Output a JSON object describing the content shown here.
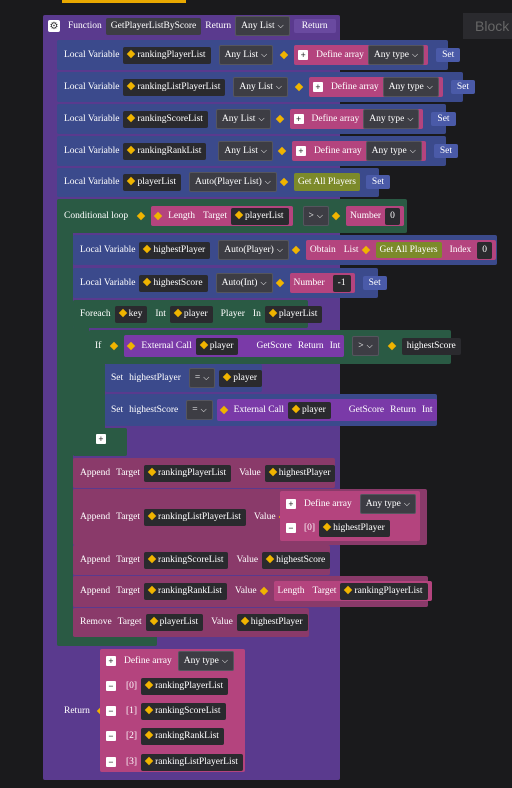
{
  "toolbar": {
    "block_tab": "Block"
  },
  "func": {
    "label": "Function",
    "name": "GetPlayerListByScore",
    "return_label": "Return",
    "return_type": "Any List",
    "return_btn": "Return"
  },
  "locals": [
    {
      "label": "Local Variable",
      "name": "rankingPlayerList",
      "type": "Any List",
      "value_label": "Define array",
      "value_type": "Any type",
      "set": "Set"
    },
    {
      "label": "Local Variable",
      "name": "rankingListPlayerList",
      "type": "Any List",
      "value_label": "Define array",
      "value_type": "Any type",
      "set": "Set"
    },
    {
      "label": "Local Variable",
      "name": "rankingScoreList",
      "type": "Any List",
      "value_label": "Define array",
      "value_type": "Any type",
      "set": "Set"
    },
    {
      "label": "Local Variable",
      "name": "rankingRankList",
      "type": "Any List",
      "value_label": "Define array",
      "value_type": "Any type",
      "set": "Set"
    },
    {
      "label": "Local Variable",
      "name": "playerList",
      "type": "Auto(Player List)",
      "value_label": "Get All Players",
      "set": "Set"
    }
  ],
  "loop": {
    "label": "Conditional loop",
    "length_label": "Length",
    "target_label": "Target",
    "target": "playerList",
    "op": ">",
    "number_label": "Number",
    "number": "0"
  },
  "inner": {
    "hp": {
      "label": "Local Variable",
      "name": "highestPlayer",
      "type": "Auto(Player)",
      "obtain": "Obtain",
      "list_label": "List",
      "list_value": "Get All Players",
      "index_label": "Index",
      "index": "0"
    },
    "hs": {
      "label": "Local Variable",
      "name": "highestScore",
      "type": "Auto(Int)",
      "number_label": "Number",
      "number": "-1",
      "set": "Set"
    },
    "foreach": {
      "label": "Foreach",
      "key": "key",
      "type1": "Int",
      "player": "player",
      "type2": "Player",
      "in_label": "In",
      "list": "playerList"
    },
    "if": {
      "label": "If",
      "ext": "External Call",
      "player": "player",
      "method": "GetScore",
      "ret": "Return",
      "ret_type": "Int",
      "op": ">",
      "cmp": "highestScore"
    },
    "set1": {
      "label": "Set",
      "name": "highestPlayer",
      "op": "=",
      "value": "player"
    },
    "set2": {
      "label": "Set",
      "name": "highestScore",
      "op": "=",
      "ext": "External Call",
      "player": "player",
      "method": "GetScore",
      "ret": "Return",
      "ret_type": "Int"
    },
    "appends": [
      {
        "label": "Append",
        "target_label": "Target",
        "target": "rankingPlayerList",
        "value_label": "Value",
        "value": "highestPlayer"
      },
      {
        "label": "Append",
        "target_label": "Target",
        "target": "rankingListPlayerList",
        "value_label": "Value",
        "arr_label": "Define array",
        "arr_type": "Any type",
        "idx": "[0]",
        "idx_value": "highestPlayer"
      },
      {
        "label": "Append",
        "target_label": "Target",
        "target": "rankingScoreList",
        "value_label": "Value",
        "value": "highestScore"
      },
      {
        "label": "Append",
        "target_label": "Target",
        "target": "rankingRankList",
        "value_label": "Value",
        "len_label": "Length",
        "len_target_label": "Target",
        "len_target": "rankingPlayerList"
      }
    ],
    "remove": {
      "label": "Remove",
      "target_label": "Target",
      "target": "playerList",
      "value_label": "Value",
      "value": "highestPlayer"
    }
  },
  "ret": {
    "label": "Return",
    "arr_label": "Define array",
    "arr_type": "Any type",
    "items": [
      {
        "idx": "[0]",
        "value": "rankingPlayerList"
      },
      {
        "idx": "[1]",
        "value": "rankingScoreList"
      },
      {
        "idx": "[2]",
        "value": "rankingRankList"
      },
      {
        "idx": "[3]",
        "value": "rankingListPlayerList"
      }
    ]
  },
  "colors": {
    "function": "#5a3a8e",
    "local": "#3b4a8c",
    "loop": "#2a5a44",
    "append": "#8a3a6a",
    "return": "#5a3a8e"
  }
}
